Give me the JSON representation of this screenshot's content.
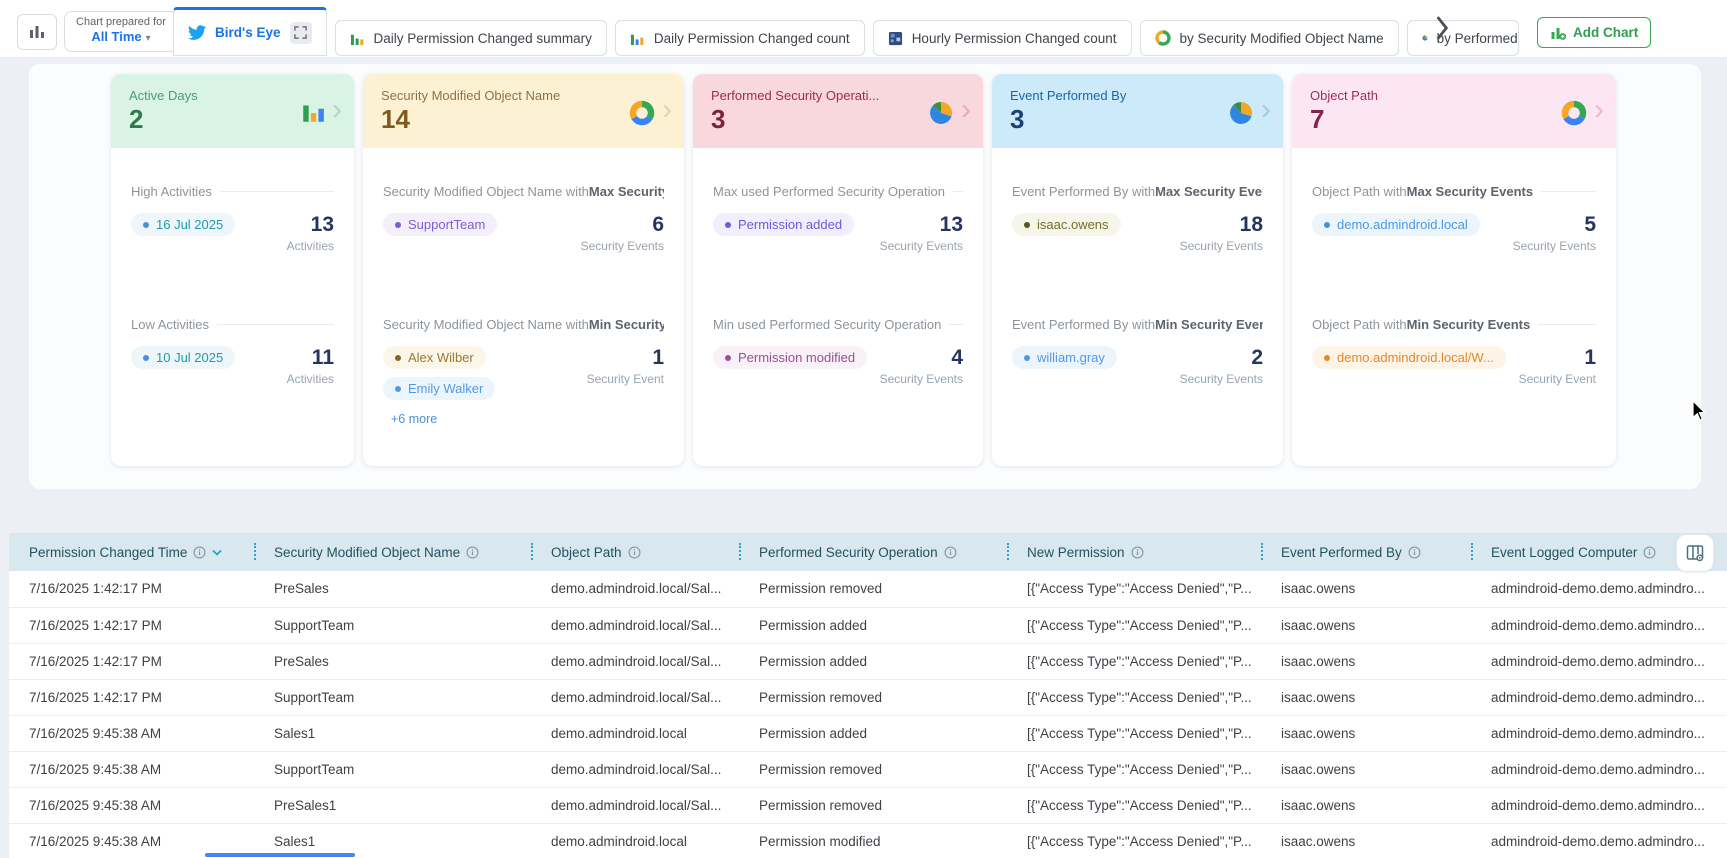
{
  "topbar": {
    "chart_selector": {
      "line1": "Chart prepared for",
      "line2": "All Time"
    },
    "tabs": [
      {
        "label": "Bird's Eye",
        "icon": "bird",
        "active": true
      },
      {
        "label": "Daily Permission Changed summary",
        "icon": "bar-chart"
      },
      {
        "label": "Daily Permission Changed count",
        "icon": "bar-chart"
      },
      {
        "label": "Hourly Permission Changed count",
        "icon": "heatmap"
      },
      {
        "label": "by Security Modified Object Name",
        "icon": "donut"
      },
      {
        "label": "by Performed",
        "icon": "pie"
      }
    ],
    "add_chart_label": "Add Chart"
  },
  "cards": [
    {
      "title": "Active Days",
      "value": "2",
      "icon": "bar-chart",
      "theme": {
        "bg": "#d9f3e5",
        "title": "#4c9d70",
        "value": "#2f7a4d",
        "chevron": "#a9d9bf"
      },
      "sections": [
        {
          "h1": "High Activities",
          "h2": "",
          "pills": [
            {
              "label": "16 Jul 2025",
              "text": "#1f9bae",
              "dot": "#4a90d9",
              "bg": "#eef6fa"
            }
          ],
          "count": "13",
          "count_label": "Activities"
        },
        {
          "h1": "Low Activities",
          "h2": "",
          "pills": [
            {
              "label": "10 Jul 2025",
              "text": "#1f9bae",
              "dot": "#4a90d9",
              "bg": "#eef6fa"
            }
          ],
          "count": "11",
          "count_label": "Activities"
        }
      ]
    },
    {
      "title": "Security Modified Object Name",
      "value": "14",
      "icon": "donut",
      "theme": {
        "bg": "#fdf1d4",
        "title": "#8f7346",
        "value": "#7c5b1e",
        "chevron": "#e6d2a4"
      },
      "sections": [
        {
          "h1": "Security Modified Object Name with ",
          "h2": "Max Security ...",
          "pills": [
            {
              "label": "SupportTeam",
              "text": "#7d5cd8",
              "dot": "#7d5cd8",
              "bg": "#f3f0fb"
            }
          ],
          "count": "6",
          "count_label": "Security Events"
        },
        {
          "h1": "Security Modified Object Name with ",
          "h2": "Min Security ...",
          "pills": [
            {
              "label": "Alex Wilber",
              "text": "#9c7a2d",
              "dot": "#8a6420",
              "bg": "#faf6ea"
            },
            {
              "label": "Emily Walker",
              "text": "#539ae0",
              "dot": "#539ae0",
              "bg": "#edf5fc"
            }
          ],
          "more": "+6 more",
          "count": "1",
          "count_label": "Security Event"
        }
      ]
    },
    {
      "title": "Performed Security Operati...",
      "value": "3",
      "icon": "pie",
      "theme": {
        "bg": "#f9d8dd",
        "title": "#a02c48",
        "value": "#801f3a",
        "chevron": "#e8abb6"
      },
      "sections": [
        {
          "h1": "Max used Performed Security Operation",
          "h2": "",
          "pills": [
            {
              "label": "Permission added",
              "text": "#6b5ae0",
              "dot": "#6b5ae0",
              "bg": "#f1effb"
            }
          ],
          "count": "13",
          "count_label": "Security Events"
        },
        {
          "h1": "Min used Performed Security Operation",
          "h2": "",
          "pills": [
            {
              "label": "Permission modified",
              "text": "#9b4f94",
              "dot": "#9b4f94",
              "bg": "#f8f1f7"
            }
          ],
          "count": "4",
          "count_label": "Security Events"
        }
      ]
    },
    {
      "title": "Event Performed By",
      "value": "3",
      "icon": "pie",
      "theme": {
        "bg": "#cdeafb",
        "title": "#1767ab",
        "value": "#1d3f75",
        "chevron": "#9ccbe9"
      },
      "sections": [
        {
          "h1": "Event Performed By with ",
          "h2": "Max Security Events",
          "pills": [
            {
              "label": "isaac.owens",
              "text": "#70712a",
              "dot": "#55591f",
              "bg": "#f6f5e9"
            }
          ],
          "count": "18",
          "count_label": "Security Events"
        },
        {
          "h1": "Event Performed By with ",
          "h2": "Min Security Events",
          "pills": [
            {
              "label": "william.gray",
              "text": "#539ae0",
              "dot": "#539ae0",
              "bg": "#edf5fc"
            }
          ],
          "count": "2",
          "count_label": "Security Events"
        }
      ]
    },
    {
      "title": "Object Path",
      "value": "7",
      "icon": "donut",
      "theme": {
        "bg": "#fce6f1",
        "title": "#9d2f63",
        "value": "#84224e",
        "chevron": "#efb5d1"
      },
      "sections": [
        {
          "h1": "Object Path with ",
          "h2": "Max Security Events",
          "pills": [
            {
              "label": "demo.admindroid.local",
              "text": "#4a97e8",
              "dot": "#4a90d9",
              "bg": "#edf5fc"
            }
          ],
          "count": "5",
          "count_label": "Security Events"
        },
        {
          "h1": "Object Path with ",
          "h2": "Min Security Events",
          "pills": [
            {
              "label": "demo.admindroid.local/W...",
              "text": "#e08a2e",
              "dot": "#e08a2e",
              "bg": "#fdf3e6"
            }
          ],
          "count": "1",
          "count_label": "Security Event"
        }
      ]
    }
  ],
  "table": {
    "columns": [
      {
        "label": "Permission Changed Time"
      },
      {
        "label": "Security Modified Object Name"
      },
      {
        "label": "Object Path"
      },
      {
        "label": "Performed Security Operation"
      },
      {
        "label": "New Permission"
      },
      {
        "label": "Event Performed By"
      },
      {
        "label": "Event Logged Computer"
      }
    ],
    "rows": [
      [
        "7/16/2025 1:42:17 PM",
        "PreSales",
        "demo.admindroid.local/Sal...",
        "Permission removed",
        "[{\"Access Type\":\"Access Denied\",\"P...",
        "isaac.owens",
        "admindroid-demo.demo.admindro..."
      ],
      [
        "7/16/2025 1:42:17 PM",
        "SupportTeam",
        "demo.admindroid.local/Sal...",
        "Permission added",
        "[{\"Access Type\":\"Access Denied\",\"P...",
        "isaac.owens",
        "admindroid-demo.demo.admindro..."
      ],
      [
        "7/16/2025 1:42:17 PM",
        "PreSales",
        "demo.admindroid.local/Sal...",
        "Permission added",
        "[{\"Access Type\":\"Access Denied\",\"P...",
        "isaac.owens",
        "admindroid-demo.demo.admindro..."
      ],
      [
        "7/16/2025 1:42:17 PM",
        "SupportTeam",
        "demo.admindroid.local/Sal...",
        "Permission removed",
        "[{\"Access Type\":\"Access Denied\",\"P...",
        "isaac.owens",
        "admindroid-demo.demo.admindro..."
      ],
      [
        "7/16/2025 9:45:38 AM",
        "Sales1",
        "demo.admindroid.local",
        "Permission added",
        "[{\"Access Type\":\"Access Denied\",\"P...",
        "isaac.owens",
        "admindroid-demo.demo.admindro..."
      ],
      [
        "7/16/2025 9:45:38 AM",
        "SupportTeam",
        "demo.admindroid.local/Sal...",
        "Permission removed",
        "[{\"Access Type\":\"Access Denied\",\"P...",
        "isaac.owens",
        "admindroid-demo.demo.admindro..."
      ],
      [
        "7/16/2025 9:45:38 AM",
        "PreSales1",
        "demo.admindroid.local/Sal...",
        "Permission removed",
        "[{\"Access Type\":\"Access Denied\",\"P...",
        "isaac.owens",
        "admindroid-demo.demo.admindro..."
      ],
      [
        "7/16/2025 9:45:38 AM",
        "Sales1",
        "demo.admindroid.local",
        "Permission modified",
        "[{\"Access Type\":\"Access Denied\",\"P...",
        "isaac.owens",
        "admindroid-demo.demo.admindro..."
      ]
    ]
  }
}
